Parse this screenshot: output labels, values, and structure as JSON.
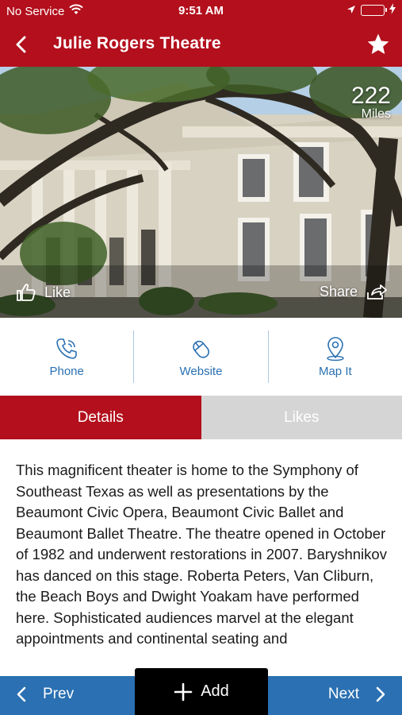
{
  "status_bar": {
    "carrier": "No Service",
    "time": "9:51 AM",
    "battery_level": 0.45,
    "icons": [
      "wifi-icon",
      "location-arrow-icon",
      "battery-icon",
      "charging-bolt-icon"
    ]
  },
  "nav": {
    "title": "Julie Rogers Theatre",
    "back_icon": "chevron-left-icon",
    "favorite_icon": "star-icon"
  },
  "hero": {
    "distance_value": "222",
    "distance_unit": "Miles",
    "like_label": "Like",
    "share_label": "Share"
  },
  "actions": [
    {
      "label": "Phone",
      "icon": "phone-icon"
    },
    {
      "label": "Website",
      "icon": "mouse-icon"
    },
    {
      "label": "Map It",
      "icon": "map-pin-icon"
    }
  ],
  "tabs": [
    {
      "label": "Details",
      "active": true
    },
    {
      "label": "Likes",
      "active": false
    }
  ],
  "description": "This magnificent theater is home to the Symphony of Southeast Texas as well as presentations by the Beaumont Civic Opera, Beaumont Civic Ballet and Beaumont Ballet Theatre. The theatre opened in October of 1982 and underwent restorations in 2007. Baryshnikov has danced on this stage. Roberta Peters, Van Cliburn, the Beach Boys and Dwight Yoakam have performed here. Sophisticated audiences marvel at the elegant appointments and continental seating and",
  "bottom_bar": {
    "prev_label": "Prev",
    "add_label": "Add",
    "next_label": "Next"
  },
  "colors": {
    "brand_red": "#b30f1c",
    "accent_blue": "#2a70b2",
    "inactive_tab": "#d5d5d5"
  }
}
